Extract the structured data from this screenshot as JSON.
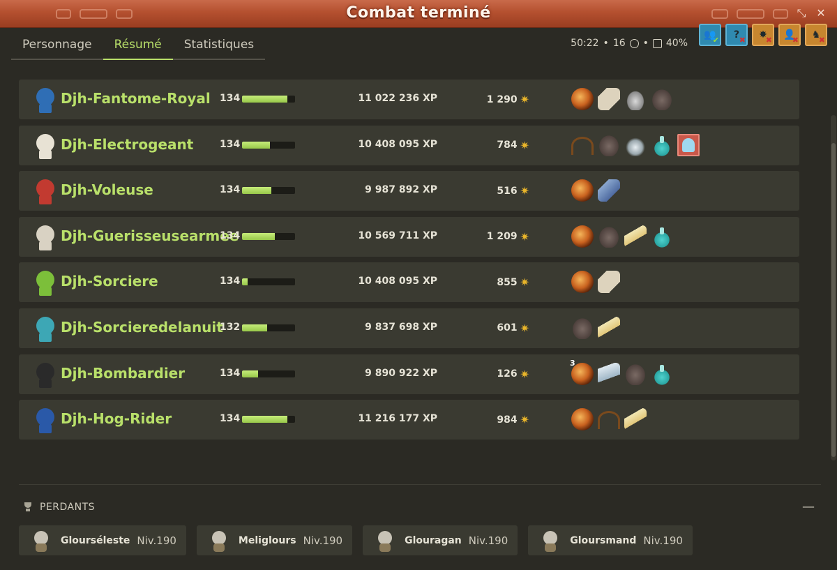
{
  "window": {
    "title": "Combat terminé"
  },
  "tabs": [
    {
      "label": "Personnage"
    },
    {
      "label": "Résumé"
    },
    {
      "label": "Statistiques"
    }
  ],
  "meta": {
    "duration": "50:22",
    "turns": "16",
    "drop_bonus": "40%"
  },
  "winners": [
    {
      "name": "Djh-Fantome-Royal",
      "level": "134",
      "xp_fill": 0.85,
      "xp": "11 022 236 XP",
      "kamas": "1 290",
      "loot": [
        "orb",
        "paper",
        "helmet",
        "rock"
      ],
      "avatar_color": "#2f6eb5"
    },
    {
      "name": "Djh-Electrogeant",
      "level": "134",
      "xp_fill": 0.52,
      "xp": "10 408 095 XP",
      "kamas": "784",
      "loot": [
        "whip",
        "rock",
        "spike",
        "potion",
        "ghost"
      ],
      "avatar_color": "#e8e2d4"
    },
    {
      "name": "Djh-Voleuse",
      "level": "134",
      "xp_fill": 0.55,
      "xp": "9 987 892 XP",
      "kamas": "516",
      "loot": [
        "orb",
        "boot"
      ],
      "avatar_color": "#c23a30"
    },
    {
      "name": "Djh-Guerisseusearmee",
      "level": "134",
      "xp_fill": 0.62,
      "xp": "10 569 711 XP",
      "kamas": "1 209",
      "loot": [
        "orb",
        "rock",
        "feather",
        "potion"
      ],
      "avatar_color": "#d9d2c3"
    },
    {
      "name": "Djh-Sorciere",
      "level": "134",
      "xp_fill": 0.1,
      "xp": "10 408 095 XP",
      "kamas": "855",
      "loot": [
        "orb",
        "paper"
      ],
      "avatar_color": "#7cbf3a"
    },
    {
      "name": "Djh-Sorcieredelanuit",
      "level": "132",
      "xp_fill": 0.48,
      "xp": "9 837 698 XP",
      "kamas": "601",
      "loot": [
        "rock",
        "feather"
      ],
      "avatar_color": "#3da7b5"
    },
    {
      "name": "Djh-Bombardier",
      "level": "134",
      "xp_fill": 0.3,
      "xp": "9 890 922 XP",
      "kamas": "126",
      "loot": [
        "orb",
        "wing",
        "rock",
        "potion"
      ],
      "loot_qty_first": "3",
      "avatar_color": "#2a2a2a"
    },
    {
      "name": "Djh-Hog-Rider",
      "level": "134",
      "xp_fill": 0.86,
      "xp": "11 216 177 XP",
      "kamas": "984",
      "loot": [
        "orb",
        "whip",
        "feather"
      ],
      "avatar_color": "#2a59a8"
    }
  ],
  "losers_section": {
    "title": "PERDANTS"
  },
  "losers": [
    {
      "name": "Glourséleste",
      "level": "Niv.190"
    },
    {
      "name": "Meliglours",
      "level": "Niv.190"
    },
    {
      "name": "Glouragan",
      "level": "Niv.190"
    },
    {
      "name": "Gloursmand",
      "level": "Niv.190"
    }
  ],
  "colors": {
    "accent": "#b9e06a",
    "title_bar": "#b4502f",
    "kamas": "#e9b52a"
  }
}
